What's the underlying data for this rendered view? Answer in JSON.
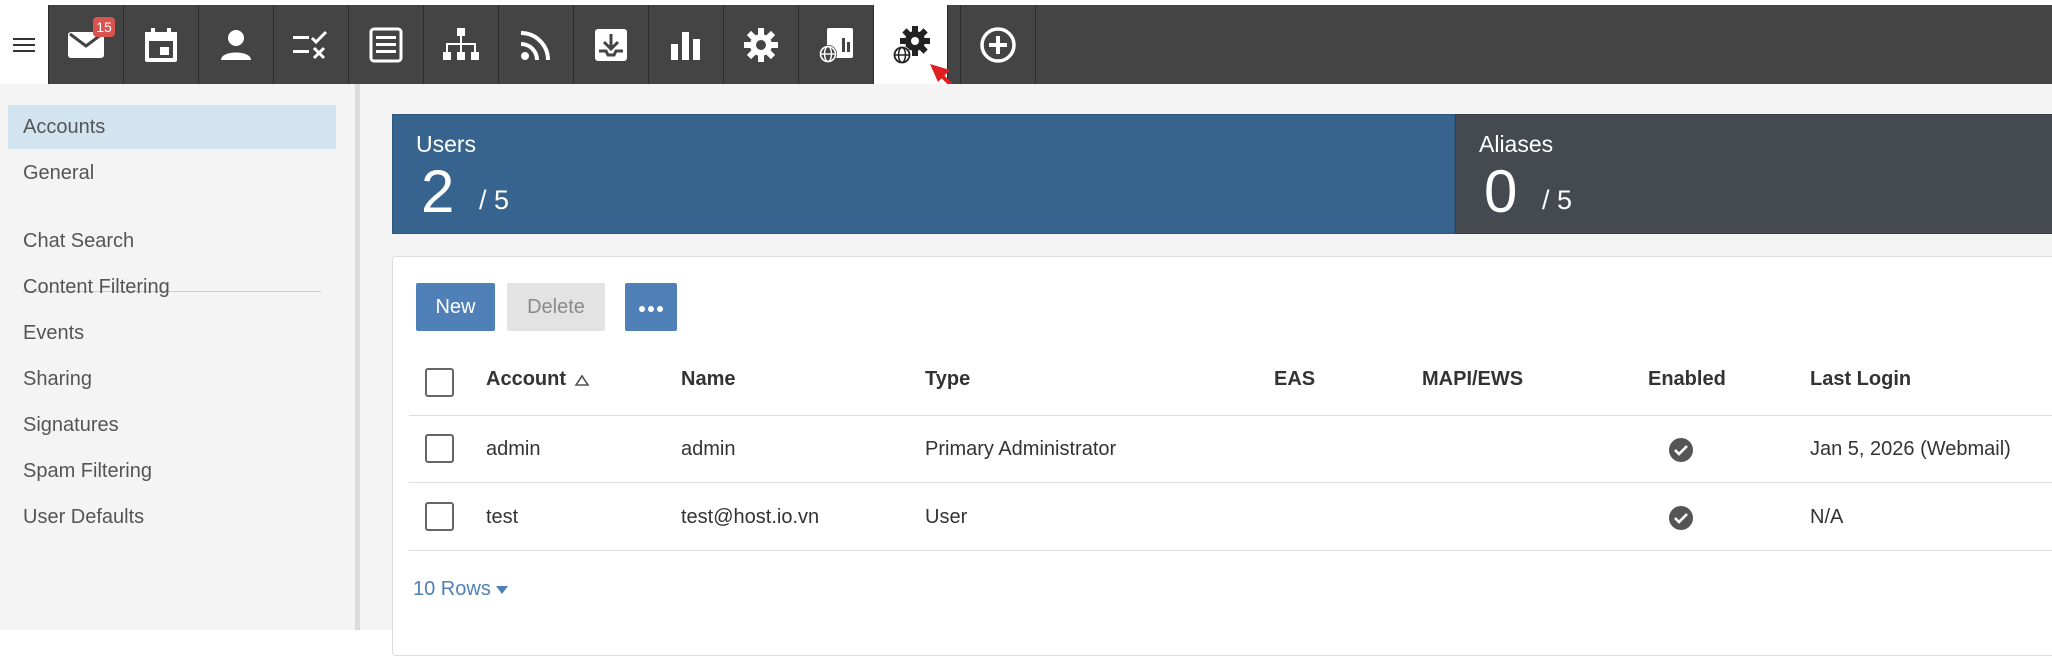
{
  "toolbar": {
    "items": [
      {
        "name": "mail",
        "badge": "15"
      },
      {
        "name": "calendar"
      },
      {
        "name": "contacts"
      },
      {
        "name": "tasks"
      },
      {
        "name": "notes"
      },
      {
        "name": "sitemap"
      },
      {
        "name": "rss"
      },
      {
        "name": "inbox-download"
      },
      {
        "name": "reports"
      },
      {
        "name": "settings"
      },
      {
        "name": "domain-reports"
      },
      {
        "name": "domain-settings",
        "active": true
      },
      {
        "name": "add"
      }
    ]
  },
  "sidebar": {
    "items": [
      {
        "label": "Accounts",
        "active": true
      },
      {
        "label": "General"
      },
      {
        "label": "Chat Search"
      },
      {
        "label": "Content Filtering"
      },
      {
        "label": "Events"
      },
      {
        "label": "Sharing"
      },
      {
        "label": "Signatures"
      },
      {
        "label": "Spam Filtering"
      },
      {
        "label": "User Defaults"
      }
    ]
  },
  "stats": {
    "users": {
      "label": "Users",
      "value": "2",
      "total": "/ 5"
    },
    "aliases": {
      "label": "Aliases",
      "value": "0",
      "total": "/ 5"
    }
  },
  "actions": {
    "new_label": "New",
    "delete_label": "Delete"
  },
  "table": {
    "columns": [
      "Account",
      "Name",
      "Type",
      "EAS",
      "MAPI/EWS",
      "Enabled",
      "Last Login"
    ],
    "rows": [
      {
        "account": "admin",
        "name": "admin",
        "type": "Primary Administrator",
        "eas": "",
        "mapi": "",
        "enabled": true,
        "last_login": "Jan 5, 2026 (Webmail)"
      },
      {
        "account": "test",
        "name": "test@host.io.vn",
        "type": "User",
        "eas": "",
        "mapi": "",
        "enabled": true,
        "last_login": "N/A"
      }
    ],
    "rows_selector": "10 Rows"
  },
  "colors": {
    "accent": "#4f80b7",
    "users_card": "#37648f",
    "aliases_card": "#444a50",
    "toolbar": "#444444",
    "annotation": "#e02020"
  }
}
